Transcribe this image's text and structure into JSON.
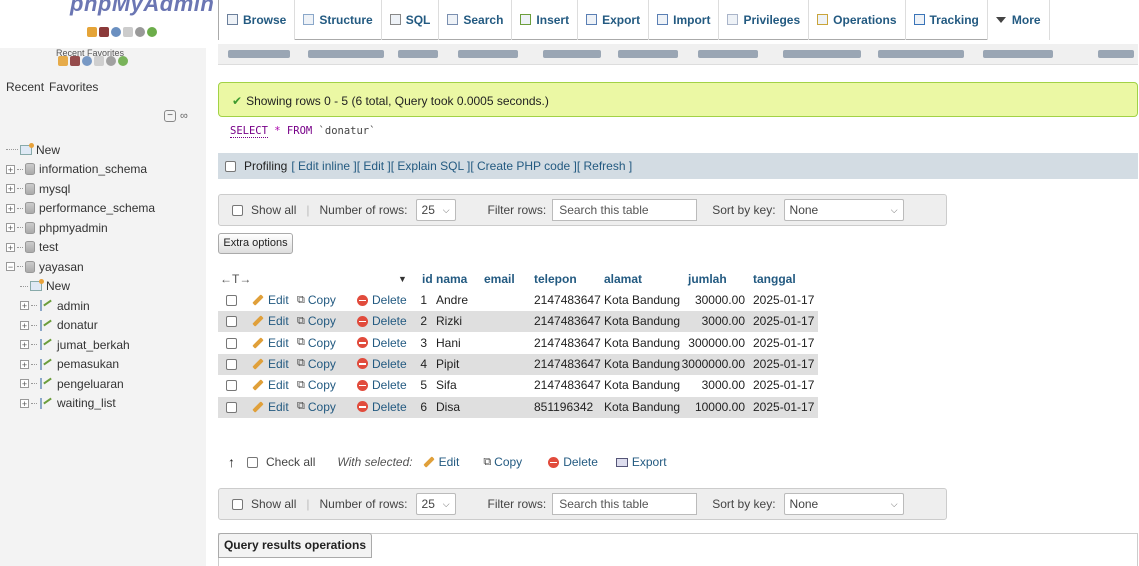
{
  "app": {
    "logo_text": "phpMyAdmin"
  },
  "sidebar": {
    "ghost_tabs": "Recent Favorites",
    "tabs": [
      "Recent",
      "Favorites"
    ],
    "tree": [
      {
        "label": "New",
        "kind": "new",
        "level": 0
      },
      {
        "label": "information_schema",
        "kind": "db",
        "level": 0
      },
      {
        "label": "mysql",
        "kind": "db",
        "level": 0
      },
      {
        "label": "performance_schema",
        "kind": "db",
        "level": 0
      },
      {
        "label": "phpmyadmin",
        "kind": "db",
        "level": 0
      },
      {
        "label": "test",
        "kind": "db",
        "level": 0
      },
      {
        "label": "yayasan",
        "kind": "db-open",
        "level": 0
      },
      {
        "label": "New",
        "kind": "new",
        "level": 1
      },
      {
        "label": "admin",
        "kind": "table",
        "level": 1
      },
      {
        "label": "donatur",
        "kind": "table",
        "level": 1,
        "selected": true
      },
      {
        "label": "jumat_berkah",
        "kind": "table",
        "level": 1
      },
      {
        "label": "pemasukan",
        "kind": "table",
        "level": 1
      },
      {
        "label": "pengeluaran",
        "kind": "table",
        "level": 1
      },
      {
        "label": "waiting_list",
        "kind": "table",
        "level": 1
      }
    ]
  },
  "topnav": {
    "tabs": [
      "Browse",
      "Structure",
      "SQL",
      "Search",
      "Insert",
      "Export",
      "Import",
      "Privileges",
      "Operations",
      "Tracking",
      "More"
    ]
  },
  "main": {
    "success_message": "Showing rows 0 - 5 (6 total, Query took 0.0005 seconds.)",
    "sql": {
      "select": "SELECT",
      "star": "*",
      "from": "FROM",
      "table": "`donatur`"
    },
    "profiling": {
      "label": "Profiling",
      "links": [
        "[ Edit inline ]",
        "[ Edit ]",
        "[ Explain SQL ]",
        "[ Create PHP code ]",
        "[ Refresh ]"
      ]
    },
    "nav": {
      "show_all": "Show all",
      "rows_label": "Number of rows:",
      "rows_value": "25",
      "filter_label": "Filter rows:",
      "filter_placeholder": "Search this table",
      "sort_label": "Sort by key:",
      "sort_value": "None"
    },
    "extra_options": "Extra options",
    "table": {
      "arrows": "←T→",
      "columns": [
        "id",
        "nama",
        "email",
        "telepon",
        "alamat",
        "jumlah",
        "tanggal"
      ],
      "actions": [
        "Edit",
        "Copy",
        "Delete"
      ],
      "rows": [
        {
          "id": "1",
          "nama": "Andre",
          "email": "",
          "telepon": "2147483647",
          "alamat": "Kota Bandung",
          "jumlah": "30000.00",
          "tanggal": "2025-01-17"
        },
        {
          "id": "2",
          "nama": "Rizki",
          "email": "",
          "telepon": "2147483647",
          "alamat": "Kota Bandung",
          "jumlah": "3000.00",
          "tanggal": "2025-01-17"
        },
        {
          "id": "3",
          "nama": "Hani",
          "email": "",
          "telepon": "2147483647",
          "alamat": "Kota Bandung",
          "jumlah": "300000.00",
          "tanggal": "2025-01-17"
        },
        {
          "id": "4",
          "nama": "Pipit",
          "email": "",
          "telepon": "2147483647",
          "alamat": "Kota Bandung",
          "jumlah": "3000000.00",
          "tanggal": "2025-01-17"
        },
        {
          "id": "5",
          "nama": "Sifa",
          "email": "",
          "telepon": "2147483647",
          "alamat": "Kota Bandung",
          "jumlah": "3000.00",
          "tanggal": "2025-01-17"
        },
        {
          "id": "6",
          "nama": "Disa",
          "email": "",
          "telepon": "851196342",
          "alamat": "Kota Bandung",
          "jumlah": "10000.00",
          "tanggal": "2025-01-17"
        }
      ]
    },
    "bulk": {
      "check_all": "Check all",
      "with_selected": "With selected:",
      "edit": "Edit",
      "copy": "Copy",
      "delete": "Delete",
      "export": "Export"
    },
    "query_results_ops": "Query results operations"
  },
  "colors": {
    "success_bg": "#ebf8a4",
    "success_border": "#a2d246",
    "link": "#235a81",
    "row_odd": "#ffffff",
    "row_even": "#dfdfdf"
  }
}
